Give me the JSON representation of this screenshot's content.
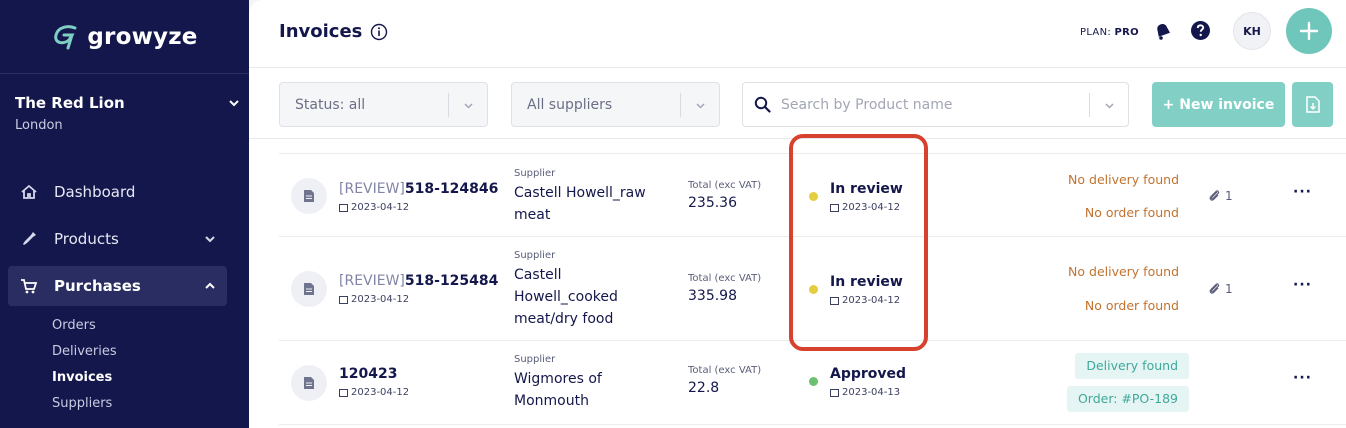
{
  "brand": {
    "name": "growyze"
  },
  "venue": {
    "name": "The Red Lion",
    "city": "London"
  },
  "nav": {
    "dashboard": "Dashboard",
    "products": "Products",
    "purchases": "Purchases",
    "sub": [
      "Orders",
      "Deliveries",
      "Invoices",
      "Suppliers"
    ]
  },
  "header": {
    "title": "Invoices",
    "plan_label": "PLAN:",
    "plan_value": "PRO",
    "avatar_initials": "KH"
  },
  "filters": {
    "status": "Status: all",
    "suppliers": "All suppliers",
    "search_placeholder": "Search by Product name",
    "new_invoice": "+ New invoice"
  },
  "table": {
    "rows": [
      {
        "prefix": "[REVIEW]",
        "number": "518-124846",
        "date": "2023-04-12",
        "supplier_label": "Supplier",
        "supplier": "Castell Howell_raw meat",
        "total_label": "Total (exc VAT)",
        "total": "235.36",
        "status": "In review",
        "status_date": "2023-04-12",
        "status_color": "#e6cc3f",
        "delivery": "No delivery found",
        "order": "No order found",
        "attachments": "1"
      },
      {
        "prefix": "[REVIEW]",
        "number": "518-125484",
        "date": "2023-04-12",
        "supplier_label": "Supplier",
        "supplier": "Castell Howell_cooked meat/dry food",
        "total_label": "Total (exc VAT)",
        "total": "335.98",
        "status": "In review",
        "status_date": "2023-04-12",
        "status_color": "#e6cc3f",
        "delivery": "No delivery found",
        "order": "No order found",
        "attachments": "1"
      },
      {
        "prefix": "",
        "number": "120423",
        "date": "2023-04-12",
        "supplier_label": "Supplier",
        "supplier": "Wigmores of Monmouth",
        "total_label": "Total (exc VAT)",
        "total": "22.8",
        "status": "Approved",
        "status_date": "2023-04-13",
        "status_color": "#6cc070",
        "delivery": "Delivery found",
        "order": "Order: #PO-189",
        "attachments": ""
      }
    ]
  },
  "colors": {
    "sidebar": "#14174b",
    "accent": "#6fc6bb",
    "highlight": "#d6422e",
    "warning": "#c2732f"
  }
}
